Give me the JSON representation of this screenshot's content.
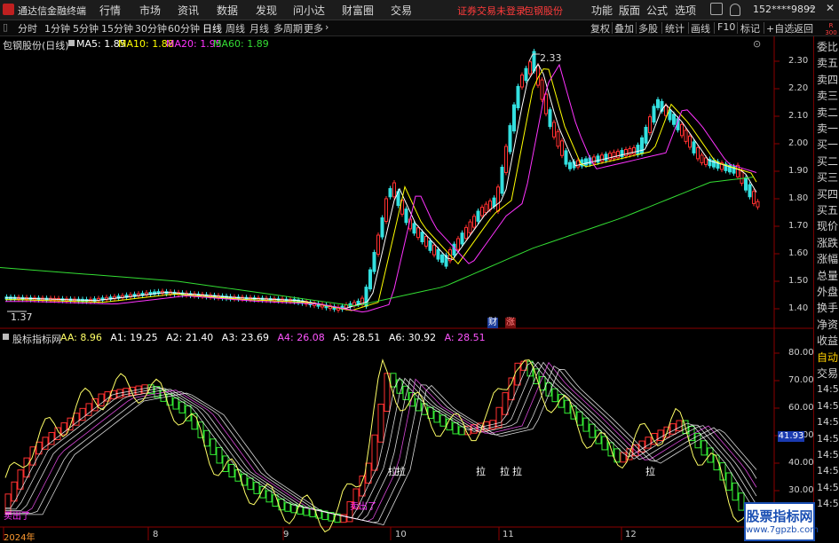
{
  "app": {
    "title": "通达信金融终端"
  },
  "menu": [
    "行情",
    "市场",
    "资讯",
    "数据",
    "发现",
    "问小达",
    "财富圈",
    "交易"
  ],
  "login_notice": "证券交易未登录",
  "stock_name": "包钢股份",
  "top_right": [
    "功能",
    "版面",
    "公式",
    "选项"
  ],
  "account": "152****9892",
  "periods": [
    "分时",
    "1分钟",
    "5分钟",
    "15分钟",
    "30分钟",
    "60分钟",
    "日线",
    "周线",
    "月线",
    "多周期",
    "更多"
  ],
  "active_period": "日线",
  "toolbar_right": [
    "复权",
    "叠加",
    "多股",
    "统计",
    "画线",
    "F10",
    "标记",
    "+自选",
    "返回"
  ],
  "chart_title": "包钢股份(日线)",
  "ma_legend": [
    {
      "label": "MA5: 1.85",
      "color": "#ffffff"
    },
    {
      "label": "MA10: 1.88",
      "color": "#ffff00"
    },
    {
      "label": "MA20: 1.95",
      "color": "#ff33ff"
    },
    {
      "label": "MA60: 1.89",
      "color": "#33dd33"
    }
  ],
  "price_axis": [
    "2.30",
    "2.20",
    "2.10",
    "2.00",
    "1.90",
    "1.80",
    "1.70",
    "1.60",
    "1.50",
    "1.40"
  ],
  "price_high_label": "2.33",
  "price_low_label": "1.37",
  "markers": {
    "cai": "财",
    "zhang": "涨"
  },
  "indicator_name": "股标指标网",
  "indicator_legend": [
    {
      "label": "AA: 8.96",
      "color": "#ffff66"
    },
    {
      "label": "A1: 19.25",
      "color": "#ffffff"
    },
    {
      "label": "A2: 21.40",
      "color": "#ffffff"
    },
    {
      "label": "A3: 23.69",
      "color": "#ffffff"
    },
    {
      "label": "A4: 26.08",
      "color": "#ff55ff"
    },
    {
      "label": "A5: 28.51",
      "color": "#ffffff"
    },
    {
      "label": "A6: 30.92",
      "color": "#ffffff"
    },
    {
      "label": "A: 28.51",
      "color": "#ff55ff"
    }
  ],
  "ind_axis": [
    "80.00",
    "70.00",
    "60.00",
    "50.00",
    "40.00",
    "30.00",
    "20.00"
  ],
  "ind_current": "41.93",
  "la_labels": [
    "拉",
    "拉",
    "拉",
    "拉",
    "拉",
    "拉"
  ],
  "sell_labels": [
    "卖出了",
    "卖出了"
  ],
  "date_axis": [
    "2024年",
    "8",
    "9",
    "10",
    "11",
    "12"
  ],
  "right_panel": [
    "委比",
    "卖五",
    "卖四",
    "卖三",
    "卖二",
    "卖一",
    "买一",
    "买二",
    "买三",
    "买四",
    "买五",
    "现价",
    "涨跌",
    "涨幅",
    "总量",
    "外盘",
    "换手",
    "净资",
    "收益",
    "自动",
    "交易",
    "14:56",
    "14:56",
    "14:56",
    "14:56",
    "14:56",
    "14:56",
    "14:56",
    "14:56"
  ],
  "r300": "R 300",
  "watermark": {
    "line1": "股票指标网",
    "line2": "www.7gpzb.com"
  }
}
